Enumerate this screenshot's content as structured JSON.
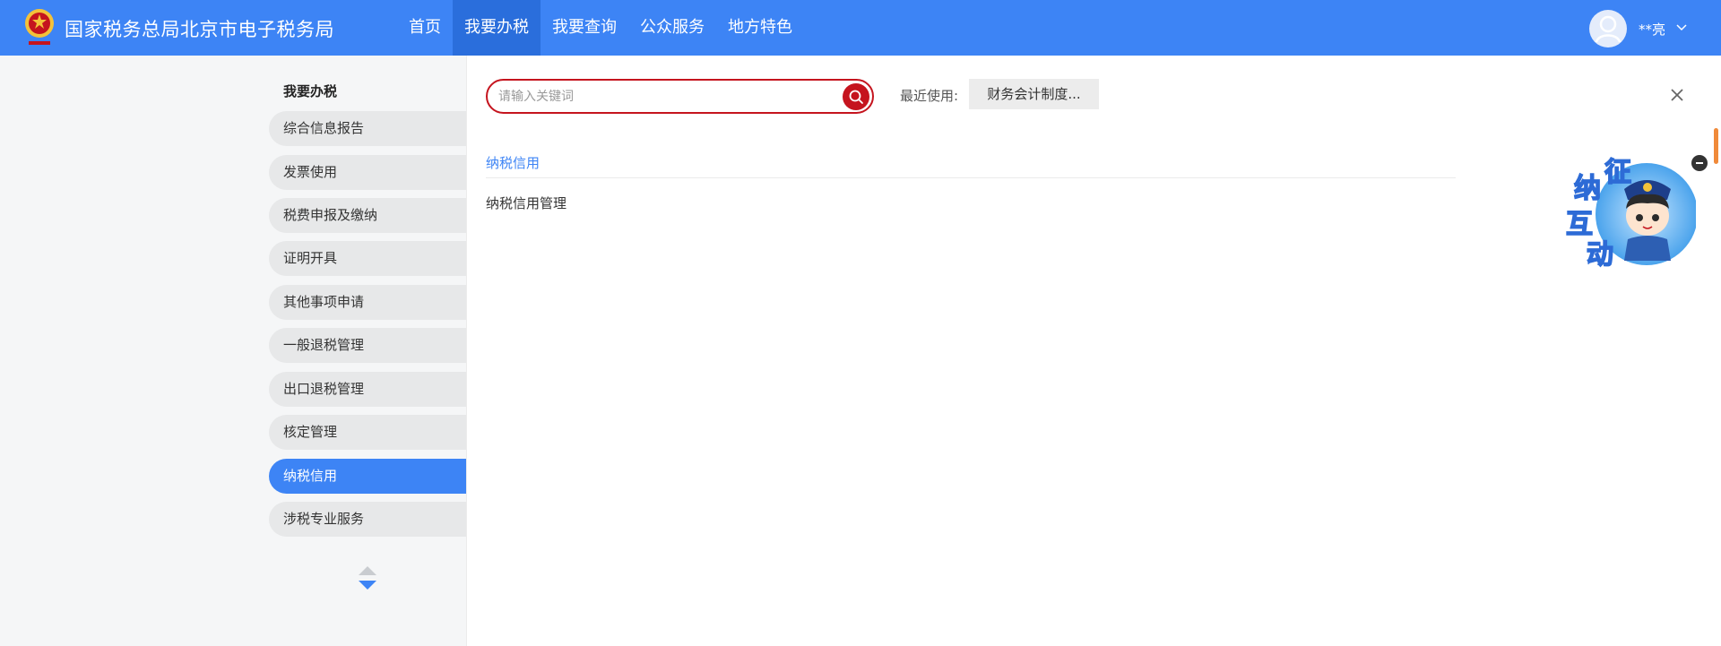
{
  "header": {
    "site_title": "国家税务总局北京市电子税务局",
    "nav": [
      "首页",
      "我要办税",
      "我要查询",
      "公众服务",
      "地方特色"
    ],
    "active_nav": "我要办税",
    "user_name": "**亮"
  },
  "sidebar": {
    "title": "我要办税",
    "items": [
      {
        "label": "综合信息报告"
      },
      {
        "label": "发票使用"
      },
      {
        "label": "税费申报及缴纳"
      },
      {
        "label": "证明开具"
      },
      {
        "label": "其他事项申请"
      },
      {
        "label": "一般退税管理"
      },
      {
        "label": "出口退税管理"
      },
      {
        "label": "核定管理"
      },
      {
        "label": "纳税信用",
        "active": true
      },
      {
        "label": "涉税专业服务"
      }
    ]
  },
  "main": {
    "search_placeholder": "请输入关键词",
    "search_value": "",
    "recent_label": "最近使用:",
    "recent_item": "财务会计制度...",
    "section_heading": "纳税信用",
    "results": [
      "纳税信用管理"
    ]
  },
  "assistant": {
    "chars": [
      "征",
      "纳",
      "互",
      "动"
    ]
  },
  "colors": {
    "header": "#3d84f5",
    "active_nav": "#2a6edc",
    "search_accent": "#c5141e",
    "sidebar_bg": "#f5f6f7",
    "sidebar_item": "#e7e8e9"
  },
  "icons": [
    "emblem-logo",
    "user-avatar-icon",
    "chevron-down-icon",
    "search-icon",
    "close-icon",
    "scroll-up-icon",
    "scroll-down-icon",
    "minimize-icon"
  ]
}
